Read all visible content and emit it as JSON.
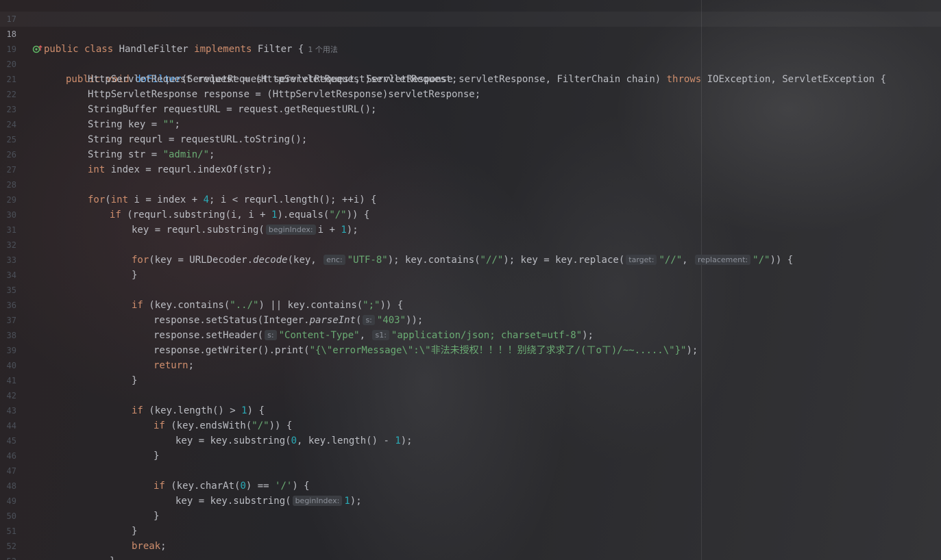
{
  "lines": [
    {
      "n": "17"
    },
    {
      "n": "18",
      "t1": "public class ",
      "t2": "HandleFilter",
      "t3": " implements ",
      "t4": "Filter {",
      "usage": "1 个用法"
    },
    {
      "n": "19",
      "gutter_icon": "implementation-marker-icon",
      "t1": "public void ",
      "t2": "doFilter",
      "t3": "(ServletRequest servletRequest, ServletResponse servletResponse, FilterChain chain) ",
      "t4": "throws",
      "t5": " IOException, ServletException {"
    },
    {
      "n": "20",
      "t1": "HttpServletRequest request = (HttpServletRequest)servletRequest;"
    },
    {
      "n": "21",
      "t1": "HttpServletResponse response = (HttpServletResponse)servletResponse;"
    },
    {
      "n": "22",
      "t1": "StringBuffer requestURL = request.getRequestURL();"
    },
    {
      "n": "23",
      "t1": "String key = ",
      "t2": "\"\"",
      "t3": ";"
    },
    {
      "n": "24",
      "t1": "String requrl = requestURL.toString();"
    },
    {
      "n": "25",
      "t1": "String str = ",
      "t2": "\"admin/\"",
      "t3": ";"
    },
    {
      "n": "26",
      "t1": "int",
      "t2": " index = requrl.indexOf(str);"
    },
    {
      "n": "27"
    },
    {
      "n": "28",
      "t1": "for",
      "t2": "(",
      "t3": "int",
      "t4": " i = index + ",
      "t5": "4",
      "t6": "; i < requrl.length(); ++i) {"
    },
    {
      "n": "29",
      "t1": "if",
      "t2": " (requrl.substring(i, i + ",
      "t3": "1",
      "t4": ").equals(",
      "t5": "\"/\"",
      "t6": ")) {"
    },
    {
      "n": "30",
      "t1": "key = requrl.substring(",
      "hint1": "beginIndex:",
      "t2": "i + ",
      "t3": "1",
      "t4": ");"
    },
    {
      "n": "31"
    },
    {
      "n": "32",
      "t1": "for",
      "t2": "(key = URLDecoder.",
      "t3": "decode",
      "t4": "(key, ",
      "hint1": "enc:",
      "t5": "\"UTF-8\"",
      "t6": "); key.contains(",
      "t7": "\"//\"",
      "t8": "); key = key.replace(",
      "hint2": "target:",
      "t9": "\"//\"",
      "t10": ", ",
      "hint3": "replacement:",
      "t11": "\"/\"",
      "t12": ")) {"
    },
    {
      "n": "33",
      "t1": "}"
    },
    {
      "n": "34"
    },
    {
      "n": "35",
      "t1": "if",
      "t2": " (key.contains(",
      "t3": "\"../\"",
      "t4": ") || key.contains(",
      "t5": "\";\"",
      "t6": ")) {"
    },
    {
      "n": "36",
      "t1": "response.setStatus(Integer.",
      "t2": "parseInt",
      "t3": "(",
      "hint1": "s:",
      "t4": "\"403\"",
      "t5": "));"
    },
    {
      "n": "37",
      "t1": "response.setHeader(",
      "hint1": "s:",
      "t2": "\"Content-Type\"",
      "t3": ", ",
      "hint2": "s1:",
      "t4": "\"application/json; charset=utf-8\"",
      "t5": ");"
    },
    {
      "n": "38",
      "t1": "response.getWriter().print(",
      "t2": "\"{\\\"errorMessage\\\":\\\"非法未授权！！！！别绕了求求了/(ㄒoㄒ)/~~.....\\\"}\"",
      "t3": ");"
    },
    {
      "n": "39",
      "t1": "return",
      "t2": ";"
    },
    {
      "n": "40",
      "t1": "}"
    },
    {
      "n": "41"
    },
    {
      "n": "42",
      "t1": "if",
      "t2": " (key.length() > ",
      "t3": "1",
      "t4": ") {"
    },
    {
      "n": "43",
      "t1": "if",
      "t2": " (key.endsWith(",
      "t3": "\"/\"",
      "t4": ")) {"
    },
    {
      "n": "44",
      "t1": "key = key.substring(",
      "t2": "0",
      "t3": ", key.length() - ",
      "t4": "1",
      "t5": ");"
    },
    {
      "n": "45",
      "t1": "}"
    },
    {
      "n": "46"
    },
    {
      "n": "47",
      "t1": "if",
      "t2": " (key.charAt(",
      "t3": "0",
      "t4": ") == ",
      "t5": "'/'",
      "t6": ") {"
    },
    {
      "n": "48",
      "t1": "key = key.substring(",
      "hint1": "beginIndex:",
      "t2": "1",
      "t3": ");"
    },
    {
      "n": "49",
      "t1": "}"
    },
    {
      "n": "50",
      "t1": "}"
    },
    {
      "n": "51",
      "t1": "break",
      "t2": ";"
    },
    {
      "n": "52",
      "t1": "}"
    },
    {
      "n": "53",
      "t1": "}"
    }
  ]
}
